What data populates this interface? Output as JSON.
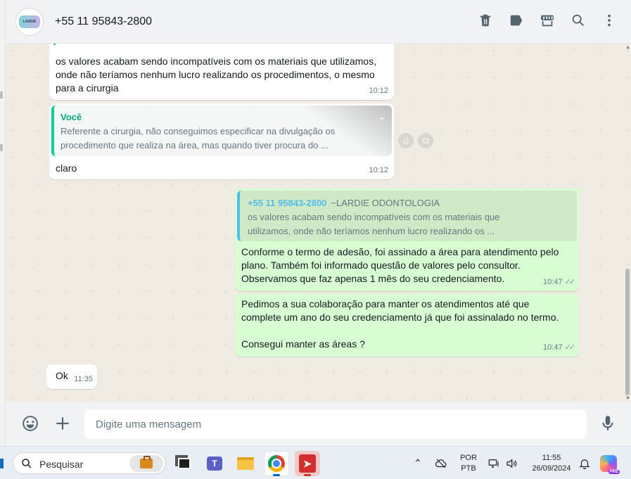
{
  "header": {
    "contact_name": "+55 11 95843-2800",
    "icons": [
      "delete-icon",
      "label-icon",
      "store-icon",
      "search-icon",
      "menu-icon"
    ]
  },
  "messages": [
    {
      "direction": "in",
      "text": "os valores acabam sendo incompatíveis com os materiais que utilizamos, onde não teríamos nenhum lucro realizando os procedimentos, o mesmo para a cirurgia",
      "time": "10:12"
    },
    {
      "direction": "in",
      "quote_author": "Você",
      "quote_text": "Referente a cirurgia, não conseguimos especificar na divulgação os procedimento que realiza na área, mas quando tiver procura do ...",
      "text": "claro",
      "time": "10:12"
    },
    {
      "direction": "out",
      "quote_author": "+55 11 95843-2800",
      "quote_pushname": "~LARDIE ODONTOLOGIA",
      "quote_text": "os valores acabam sendo incompatíveis com os materiais que utilizamos, onde não teríamos nenhum lucro realizando os ...",
      "text": "Conforme o termo de adesão, foi assinado a área para atendimento pelo plano. Também foi informado questão de valores pelo consultor. Observamos que faz apenas 1 mês do seu credenciamento.",
      "time": "10:47"
    },
    {
      "direction": "out",
      "text_line1": "Pedimos a sua colaboração para manter os atendimentos até que complete um ano do seu credenciamento já que foi assinalado no termo.",
      "text_line2": "Consegui manter as áreas ?",
      "time": "10:47"
    },
    {
      "direction": "in",
      "text": "Ok",
      "time": "11:35"
    }
  ],
  "composer": {
    "placeholder": "Digite uma mensagem"
  },
  "taskbar": {
    "search_label": "Pesquisar",
    "lang_line1": "POR",
    "lang_line2": "PTB",
    "clock_time": "11:55",
    "clock_date": "26/09/2024",
    "copilot_badge": "PRE"
  },
  "colors": {
    "outgoing_bubble": "#d9fdd3",
    "incoming_bubble": "#ffffff",
    "chat_background": "#efeae2",
    "accent_green": "#06cf9c",
    "quote_blue": "#53bdeb"
  }
}
